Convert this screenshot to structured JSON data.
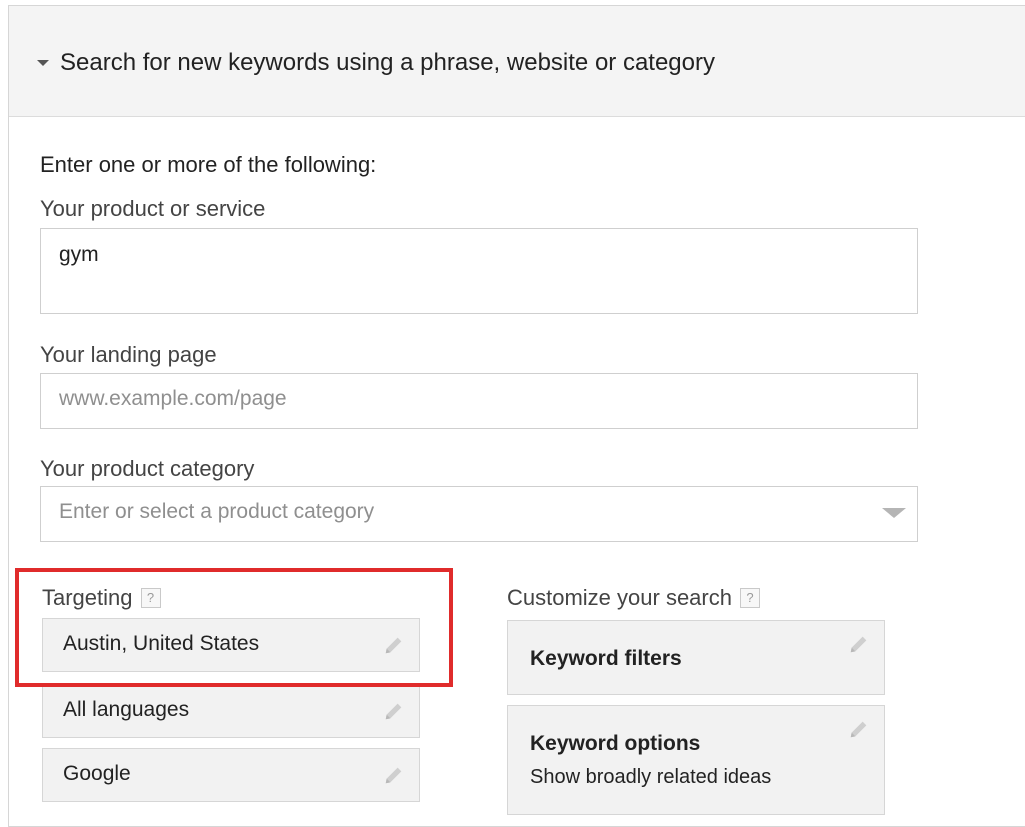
{
  "header": {
    "title": "Search for new keywords using a phrase, website or category",
    "toggle_icon": "caret-down-icon"
  },
  "form": {
    "intro": "Enter one or more of the following:",
    "product_service": {
      "label": "Your product or service",
      "value": "gym"
    },
    "landing_page": {
      "label": "Your landing page",
      "placeholder": "www.example.com/page",
      "value": ""
    },
    "product_category": {
      "label": "Your product category",
      "placeholder": "Enter or select a product category"
    }
  },
  "targeting": {
    "label": "Targeting",
    "help": "?",
    "items": [
      {
        "label": "Austin, United States",
        "icon": "pencil-icon"
      },
      {
        "label": "All languages",
        "icon": "pencil-icon"
      },
      {
        "label": "Google",
        "icon": "pencil-icon"
      }
    ]
  },
  "customize": {
    "label": "Customize your search",
    "help": "?",
    "keyword_filters": {
      "title": "Keyword filters",
      "icon": "pencil-icon"
    },
    "keyword_options": {
      "title": "Keyword options",
      "subtitle": "Show broadly related ideas",
      "icon": "pencil-icon"
    }
  },
  "colors": {
    "highlight": "#e02b2b",
    "header_bg": "#f4f4f4",
    "chip_bg": "#f2f2f2"
  }
}
